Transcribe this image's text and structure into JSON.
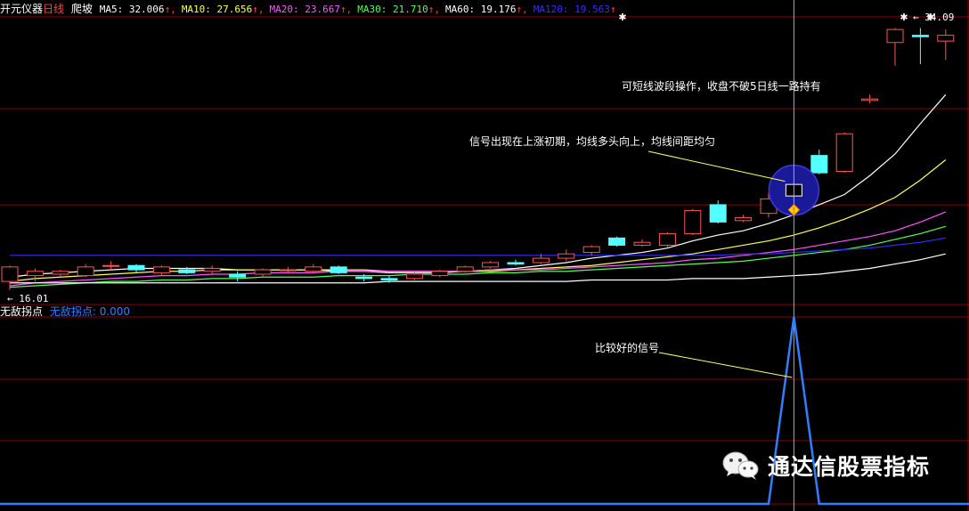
{
  "header": {
    "stock_name": "开元仪器",
    "period": "日线",
    "indicator_name": "爬坡",
    "ma_items": [
      {
        "label": "MA5: 32.006",
        "color": "#ffffff"
      },
      {
        "label": "MA10: 27.656",
        "color": "#ffff54"
      },
      {
        "label": "MA20: 23.667",
        "color": "#ff54ff"
      },
      {
        "label": "MA30: 21.710",
        "color": "#54ff54"
      },
      {
        "label": "MA60: 19.176",
        "color": "#ffffff"
      },
      {
        "label": "MA120: 19.563",
        "color": "#3030ff"
      }
    ],
    "arrow": "↑",
    "arrow_color": "#ff4040"
  },
  "price_labels": {
    "high": "34.09",
    "low": "16.01"
  },
  "sub_panel": {
    "title": "无敌拐点",
    "value_label": "无敌拐点: 0.000"
  },
  "annotations": {
    "top": "可短线波段操作，收盘不破5日线一路持有",
    "middle": "信号出现在上涨初期，均线多头向上，均线间距均匀",
    "bottom": "比较好的信号"
  },
  "watermark": {
    "text": "通达信股票指标",
    "icon": "wechat-icon"
  },
  "colors": {
    "background": "#000000",
    "up_candle": "#ff5454",
    "down_candle": "#54ffff",
    "grid": "#8b0000",
    "signal_line": "#2f7fff",
    "circle": "#1a1a99",
    "marker": "#ffd700"
  },
  "chart_data": {
    "type": "candlestick",
    "candles": [
      {
        "o": 16.6,
        "h": 17.7,
        "l": 16.0,
        "c": 17.6
      },
      {
        "o": 17.0,
        "h": 17.5,
        "l": 16.6,
        "c": 17.3
      },
      {
        "o": 17.1,
        "h": 17.4,
        "l": 16.9,
        "c": 17.3
      },
      {
        "o": 17.0,
        "h": 17.8,
        "l": 16.9,
        "c": 17.6
      },
      {
        "o": 17.7,
        "h": 18.0,
        "l": 17.4,
        "c": 17.7
      },
      {
        "o": 17.7,
        "h": 17.8,
        "l": 17.2,
        "c": 17.4
      },
      {
        "o": 17.2,
        "h": 17.7,
        "l": 17.0,
        "c": 17.6
      },
      {
        "o": 17.4,
        "h": 17.6,
        "l": 17.1,
        "c": 17.2
      },
      {
        "o": 17.3,
        "h": 17.7,
        "l": 17.1,
        "c": 17.5
      },
      {
        "o": 17.1,
        "h": 17.3,
        "l": 16.6,
        "c": 16.9
      },
      {
        "o": 17.1,
        "h": 17.5,
        "l": 16.9,
        "c": 17.4
      },
      {
        "o": 17.4,
        "h": 17.6,
        "l": 17.2,
        "c": 17.4
      },
      {
        "o": 17.3,
        "h": 17.8,
        "l": 17.2,
        "c": 17.6
      },
      {
        "o": 17.6,
        "h": 17.7,
        "l": 17.1,
        "c": 17.2
      },
      {
        "o": 16.9,
        "h": 17.1,
        "l": 16.6,
        "c": 16.8
      },
      {
        "o": 16.8,
        "h": 17.0,
        "l": 16.5,
        "c": 16.7
      },
      {
        "o": 16.8,
        "h": 17.3,
        "l": 16.7,
        "c": 17.1
      },
      {
        "o": 17.0,
        "h": 17.4,
        "l": 16.9,
        "c": 17.3
      },
      {
        "o": 17.3,
        "h": 17.7,
        "l": 17.2,
        "c": 17.6
      },
      {
        "o": 17.6,
        "h": 18.0,
        "l": 17.5,
        "c": 17.9
      },
      {
        "o": 17.9,
        "h": 18.1,
        "l": 17.7,
        "c": 17.8
      },
      {
        "o": 17.9,
        "h": 18.5,
        "l": 17.8,
        "c": 18.2
      },
      {
        "o": 18.2,
        "h": 18.8,
        "l": 18.0,
        "c": 18.5
      },
      {
        "o": 18.6,
        "h": 19.1,
        "l": 18.4,
        "c": 19.0
      },
      {
        "o": 19.6,
        "h": 19.7,
        "l": 19.0,
        "c": 19.1
      },
      {
        "o": 19.1,
        "h": 19.5,
        "l": 19.0,
        "c": 19.3
      },
      {
        "o": 19.1,
        "h": 20.0,
        "l": 18.9,
        "c": 19.9
      },
      {
        "o": 19.9,
        "h": 21.6,
        "l": 19.8,
        "c": 21.5
      },
      {
        "o": 21.9,
        "h": 22.2,
        "l": 20.6,
        "c": 20.7
      },
      {
        "o": 20.8,
        "h": 21.2,
        "l": 20.7,
        "c": 21.0
      },
      {
        "o": 21.3,
        "h": 22.7,
        "l": 21.0,
        "c": 22.3
      },
      {
        "o": 22.5,
        "h": 23.4,
        "l": 22.4,
        "c": 23.3
      },
      {
        "o": 25.3,
        "h": 25.7,
        "l": 24.0,
        "c": 24.1
      },
      {
        "o": 24.2,
        "h": 26.9,
        "l": 24.1,
        "c": 26.8
      },
      {
        "o": 29.1,
        "h": 29.5,
        "l": 28.9,
        "c": 29.2
      },
      {
        "o": 33.1,
        "h": 34.1,
        "l": 31.5,
        "c": 34.0
      },
      {
        "o": 33.6,
        "h": 34.1,
        "l": 31.6,
        "c": 33.5
      },
      {
        "o": 33.2,
        "h": 34.0,
        "l": 31.9,
        "c": 33.6
      }
    ],
    "ma_series": [
      {
        "name": "MA5",
        "color": "#ffffff",
        "values": [
          16.9,
          17.1,
          17.2,
          17.3,
          17.4,
          17.5,
          17.5,
          17.5,
          17.5,
          17.4,
          17.4,
          17.4,
          17.4,
          17.3,
          17.3,
          17.2,
          17.2,
          17.2,
          17.3,
          17.4,
          17.5,
          17.7,
          17.9,
          18.2,
          18.4,
          18.6,
          18.9,
          19.4,
          19.8,
          20.1,
          20.6,
          21.2,
          21.9,
          22.6,
          23.9,
          25.4,
          27.5,
          29.5
        ]
      },
      {
        "name": "MA10",
        "color": "#ffff54",
        "values": [
          16.6,
          16.8,
          16.9,
          17.0,
          17.1,
          17.2,
          17.3,
          17.3,
          17.4,
          17.4,
          17.4,
          17.4,
          17.4,
          17.4,
          17.4,
          17.3,
          17.3,
          17.3,
          17.3,
          17.3,
          17.4,
          17.5,
          17.6,
          17.7,
          17.9,
          18.1,
          18.3,
          18.5,
          18.8,
          19.1,
          19.4,
          19.8,
          20.3,
          20.9,
          21.6,
          22.4,
          23.6,
          25.0
        ]
      },
      {
        "name": "MA20",
        "color": "#ff54ff",
        "values": [
          16.3,
          16.5,
          16.6,
          16.7,
          16.8,
          16.9,
          17.0,
          17.0,
          17.1,
          17.1,
          17.2,
          17.2,
          17.2,
          17.3,
          17.3,
          17.3,
          17.3,
          17.3,
          17.3,
          17.4,
          17.4,
          17.4,
          17.5,
          17.6,
          17.7,
          17.8,
          17.9,
          18.1,
          18.2,
          18.4,
          18.6,
          18.8,
          19.1,
          19.4,
          19.7,
          20.1,
          20.7,
          21.4
        ]
      },
      {
        "name": "MA30",
        "color": "#54ff54",
        "values": [
          16.2,
          16.3,
          16.4,
          16.5,
          16.6,
          16.6,
          16.7,
          16.7,
          16.8,
          16.8,
          16.9,
          16.9,
          16.9,
          17.0,
          17.0,
          17.0,
          17.1,
          17.1,
          17.1,
          17.2,
          17.2,
          17.3,
          17.3,
          17.4,
          17.5,
          17.6,
          17.7,
          17.8,
          17.9,
          18.0,
          18.2,
          18.4,
          18.6,
          18.8,
          19.1,
          19.5,
          19.9,
          20.4
        ]
      },
      {
        "name": "MA60",
        "color": "#ffffff",
        "values": [
          16.5,
          16.5,
          16.5,
          16.5,
          16.5,
          16.5,
          16.5,
          16.5,
          16.5,
          16.5,
          16.5,
          16.5,
          16.5,
          16.5,
          16.5,
          16.6,
          16.6,
          16.6,
          16.6,
          16.6,
          16.6,
          16.6,
          16.6,
          16.7,
          16.7,
          16.7,
          16.7,
          16.8,
          16.8,
          16.8,
          16.9,
          17.0,
          17.1,
          17.3,
          17.5,
          17.8,
          18.1,
          18.5
        ]
      },
      {
        "name": "MA120",
        "color": "#3030ff",
        "values": [
          18.4,
          18.4,
          18.4,
          18.4,
          18.4,
          18.4,
          18.4,
          18.4,
          18.4,
          18.4,
          18.4,
          18.4,
          18.4,
          18.4,
          18.4,
          18.4,
          18.4,
          18.4,
          18.4,
          18.4,
          18.4,
          18.4,
          18.4,
          18.4,
          18.4,
          18.4,
          18.4,
          18.4,
          18.4,
          18.5,
          18.5,
          18.6,
          18.7,
          18.8,
          18.9,
          19.1,
          19.3,
          19.6
        ]
      }
    ],
    "signal": {
      "name": "无敌拐点",
      "values": [
        0,
        0,
        0,
        0,
        0,
        0,
        0,
        0,
        0,
        0,
        0,
        0,
        0,
        0,
        0,
        0,
        0,
        0,
        0,
        0,
        0,
        0,
        0,
        0,
        0,
        0,
        0,
        0,
        0,
        0,
        0,
        1,
        0,
        0,
        0,
        0,
        0,
        0
      ]
    },
    "signal_index": 31,
    "ylim": [
      15.5,
      34.5
    ]
  }
}
